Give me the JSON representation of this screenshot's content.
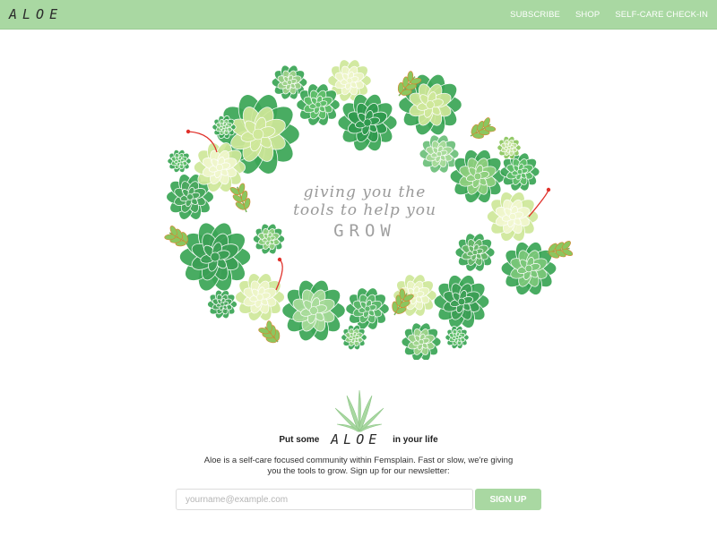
{
  "header": {
    "logo": "ALOE",
    "nav": [
      {
        "label": "SUBSCRIBE"
      },
      {
        "label": "SHOP"
      },
      {
        "label": "SELF-CARE CHECK-IN"
      }
    ]
  },
  "hero": {
    "tagline_line1": "giving you the",
    "tagline_line2": "tools to help you",
    "tagline_line3": "GROW"
  },
  "intro": {
    "put_some": "Put some",
    "brand": "ALOE",
    "in_your_life": "in your life",
    "description": "Aloe is a self-care focused community within Femsplain. Fast or slow, we're giving you the tools to grow. Sign up for our newsletter:"
  },
  "newsletter": {
    "email_placeholder": "yourname@example.com",
    "email_value": "",
    "button_label": "SIGN UP"
  },
  "colors": {
    "accent": "#a9d8a2",
    "succulent_dark": "#3aa655",
    "succulent_light": "#cfe89a",
    "flower_red": "#e0302a"
  }
}
